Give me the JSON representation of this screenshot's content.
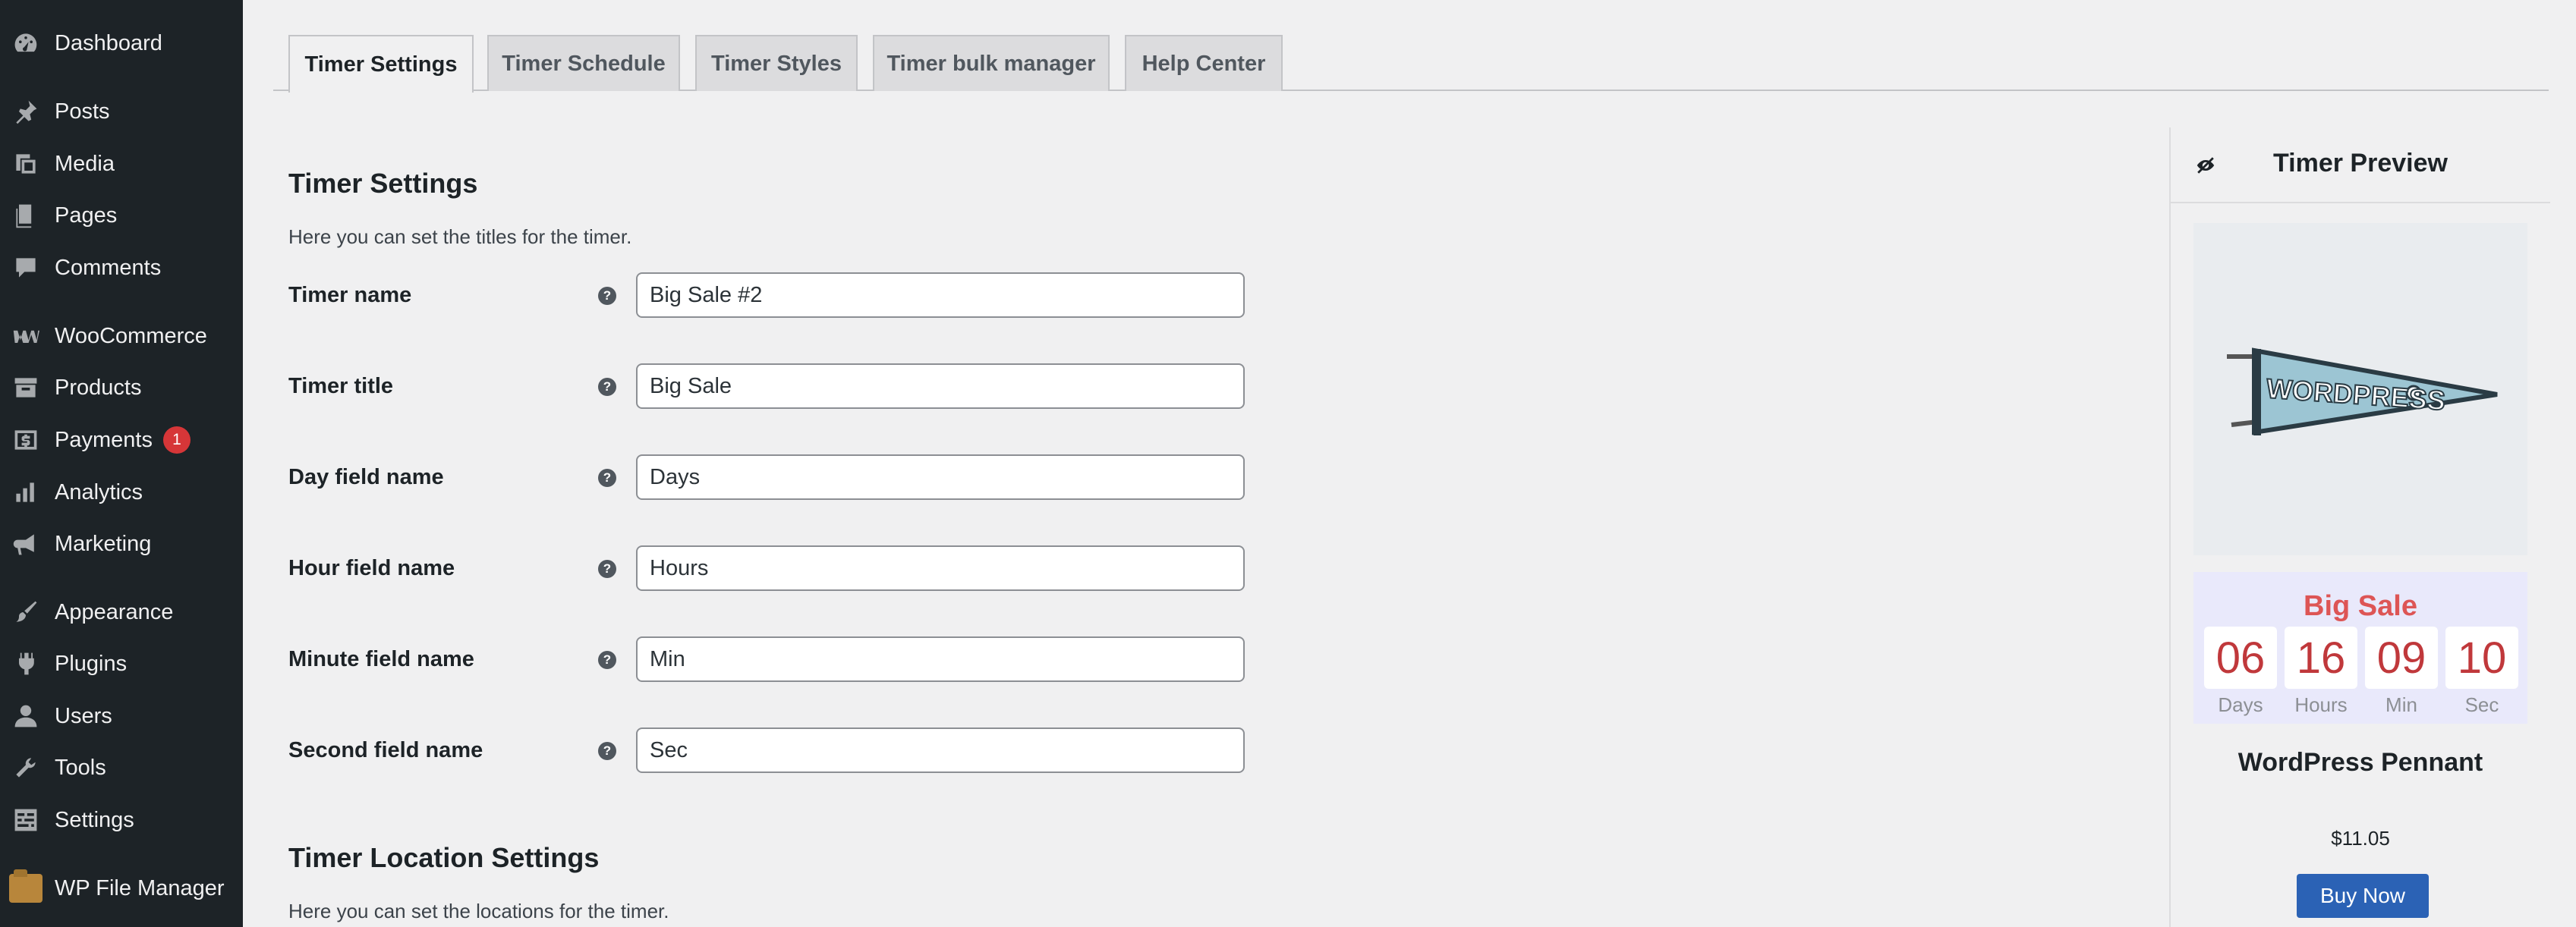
{
  "sidebar": {
    "items": [
      {
        "label": "Dashboard",
        "icon": "dashboard-icon"
      },
      {
        "label": "Posts",
        "icon": "pushpin-icon"
      },
      {
        "label": "Media",
        "icon": "media-icon"
      },
      {
        "label": "Pages",
        "icon": "pages-icon"
      },
      {
        "label": "Comments",
        "icon": "comment-icon"
      },
      {
        "label": "WooCommerce",
        "icon": "woo-icon"
      },
      {
        "label": "Products",
        "icon": "archive-icon"
      },
      {
        "label": "Payments",
        "icon": "dollar-icon",
        "badge": "1"
      },
      {
        "label": "Analytics",
        "icon": "bar-chart-icon"
      },
      {
        "label": "Marketing",
        "icon": "megaphone-icon"
      },
      {
        "label": "Appearance",
        "icon": "paintbrush-icon"
      },
      {
        "label": "Plugins",
        "icon": "plug-icon"
      },
      {
        "label": "Users",
        "icon": "user-icon"
      },
      {
        "label": "Tools",
        "icon": "wrench-icon"
      },
      {
        "label": "Settings",
        "icon": "settings-icon"
      },
      {
        "label": "WP File Manager",
        "icon": "folder-icon"
      }
    ]
  },
  "tabs": [
    {
      "label": "Timer Settings",
      "active": true
    },
    {
      "label": "Timer Schedule"
    },
    {
      "label": "Timer Styles"
    },
    {
      "label": "Timer bulk manager"
    },
    {
      "label": "Help Center"
    }
  ],
  "settings": {
    "title": "Timer Settings",
    "description": "Here you can set the titles for the timer.",
    "help_glyph": "?",
    "fields": [
      {
        "label": "Timer name",
        "value": "Big Sale #2"
      },
      {
        "label": "Timer title",
        "value": "Big Sale"
      },
      {
        "label": "Day field name",
        "value": "Days"
      },
      {
        "label": "Hour field name",
        "value": "Hours"
      },
      {
        "label": "Minute field name",
        "value": "Min"
      },
      {
        "label": "Second field name",
        "value": "Sec"
      }
    ]
  },
  "location": {
    "title": "Timer Location Settings",
    "description": "Here you can set the locations for the timer."
  },
  "preview": {
    "title": "Timer Preview",
    "timer": {
      "title": "Big Sale",
      "units": [
        {
          "value": "06",
          "label": "Days"
        },
        {
          "value": "16",
          "label": "Hours"
        },
        {
          "value": "09",
          "label": "Min"
        },
        {
          "value": "10",
          "label": "Sec"
        }
      ]
    },
    "product": {
      "image_text": "WORDPRESS",
      "name": "WordPress Pennant",
      "price": "$11.05",
      "button": "Buy Now"
    }
  },
  "colors": {
    "sidebar_bg": "#1d2327",
    "accent_red": "#dd5555",
    "button_blue": "#2b62b5",
    "badge_red": "#d63638"
  }
}
